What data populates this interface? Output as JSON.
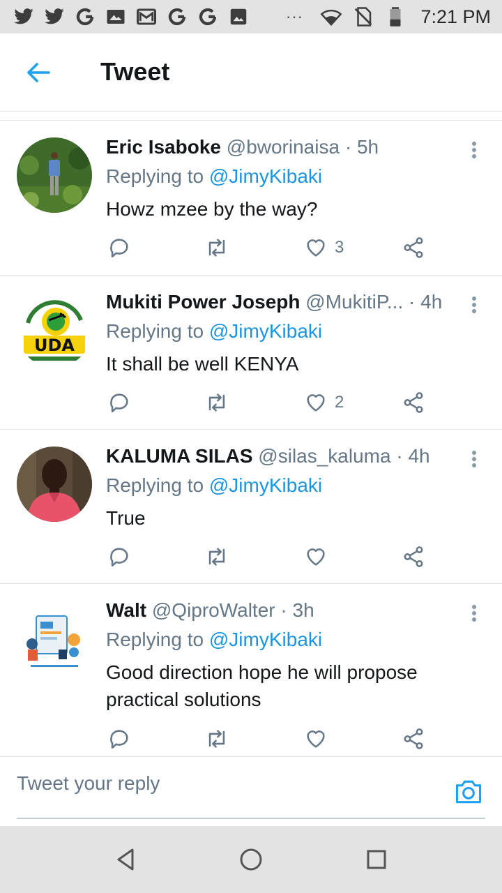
{
  "status_bar": {
    "icons": [
      "twitter-icon",
      "twitter-icon",
      "google-icon",
      "gallery-icon",
      "gmail-icon",
      "google-icon",
      "google-icon",
      "image-icon"
    ],
    "overflow": "···",
    "time": "7:21 PM"
  },
  "header": {
    "title": "Tweet"
  },
  "tweets": [
    {
      "name": "Eric Isaboke",
      "handle": "@bworinaisa",
      "separator": " · ",
      "time": "5h",
      "replying_prefix": "Replying to ",
      "replying_to": "@JimyKibaki",
      "text": "Howz mzee by the way?",
      "likes": "3"
    },
    {
      "name": "Mukiti Power Joseph",
      "handle": "@MukitiP...",
      "separator": " · ",
      "time": "4h",
      "replying_prefix": "Replying to ",
      "replying_to": "@JimyKibaki",
      "text": "It shall be well KENYA",
      "likes": "2"
    },
    {
      "name": "KALUMA SILAS",
      "handle": "@silas_kaluma",
      "separator": " · ",
      "time": "4h",
      "replying_prefix": "Replying to ",
      "replying_to": "@JimyKibaki",
      "text": "True",
      "likes": ""
    },
    {
      "name": "Walt",
      "handle": "@QiproWalter",
      "separator": " · ",
      "time": "3h",
      "replying_prefix": "Replying to ",
      "replying_to": "@JimyKibaki",
      "text": "Good direction hope he will propose practical solutions",
      "likes": ""
    }
  ],
  "reply_bar": {
    "placeholder": "Tweet your reply"
  },
  "colors": {
    "accent": "#1da1f2",
    "mention": "#1b95e0",
    "secondary_text": "#657786",
    "status_bar_bg": "#e3e3e3"
  }
}
